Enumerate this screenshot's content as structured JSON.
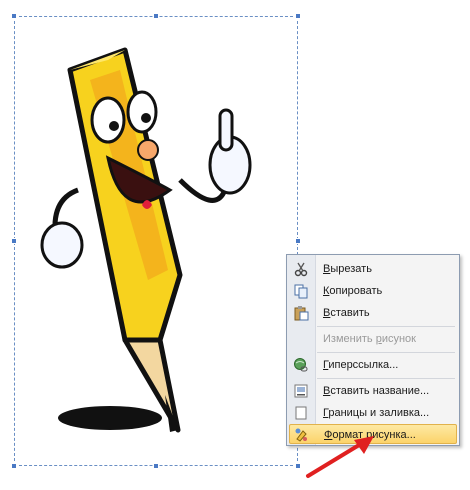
{
  "context_menu": {
    "items": [
      {
        "label_pre": "",
        "label_u": "В",
        "label_post": "ырезать",
        "icon": "scissors-icon",
        "disabled": false
      },
      {
        "label_pre": "",
        "label_u": "К",
        "label_post": "опировать",
        "icon": "copy-icon",
        "disabled": false
      },
      {
        "label_pre": "",
        "label_u": "В",
        "label_post": "ставить",
        "icon": "paste-icon",
        "disabled": false
      },
      {
        "label_pre": "Изменить ",
        "label_u": "р",
        "label_post": "исунок",
        "icon": "",
        "disabled": true
      },
      {
        "label_pre": "",
        "label_u": "Г",
        "label_post": "иперссылка...",
        "icon": "hyperlink-globe-icon",
        "disabled": false
      },
      {
        "label_pre": "",
        "label_u": "В",
        "label_post": "ставить название...",
        "icon": "insert-caption-icon",
        "disabled": false
      },
      {
        "label_pre": "",
        "label_u": "Г",
        "label_post": "раницы и заливка...",
        "icon": "borders-shading-icon",
        "disabled": false
      },
      {
        "label_pre": "",
        "label_u": "Ф",
        "label_post": "ормат рисунка...",
        "icon": "format-picture-icon",
        "disabled": false
      }
    ],
    "hovered_index": 7
  },
  "colors": {
    "accent_arrow": "#e02020",
    "selection_handle": "#4a79c4",
    "menu_hover": "#fcd36a"
  }
}
